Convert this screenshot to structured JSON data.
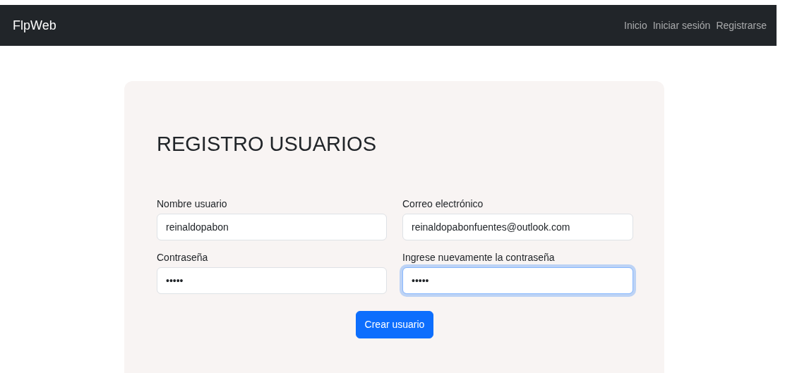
{
  "navbar": {
    "brand": "FlpWeb",
    "links": [
      {
        "label": "Inicio"
      },
      {
        "label": "Iniciar sesión"
      },
      {
        "label": "Registrarse"
      }
    ]
  },
  "form": {
    "title": "REGISTRO USUARIOS",
    "fields": [
      {
        "label": "Nombre usuario",
        "value": "reinaldopabon",
        "focused": false
      },
      {
        "label": "Correo electrónico",
        "value": "reinaldopabonfuentes@outlook.com",
        "focused": false
      },
      {
        "label": "Contraseña",
        "value": "•••••",
        "focused": false
      },
      {
        "label": "Ingrese nuevamente la contraseña",
        "value": "•••••",
        "focused": true
      }
    ],
    "button": "Crear usuario"
  }
}
